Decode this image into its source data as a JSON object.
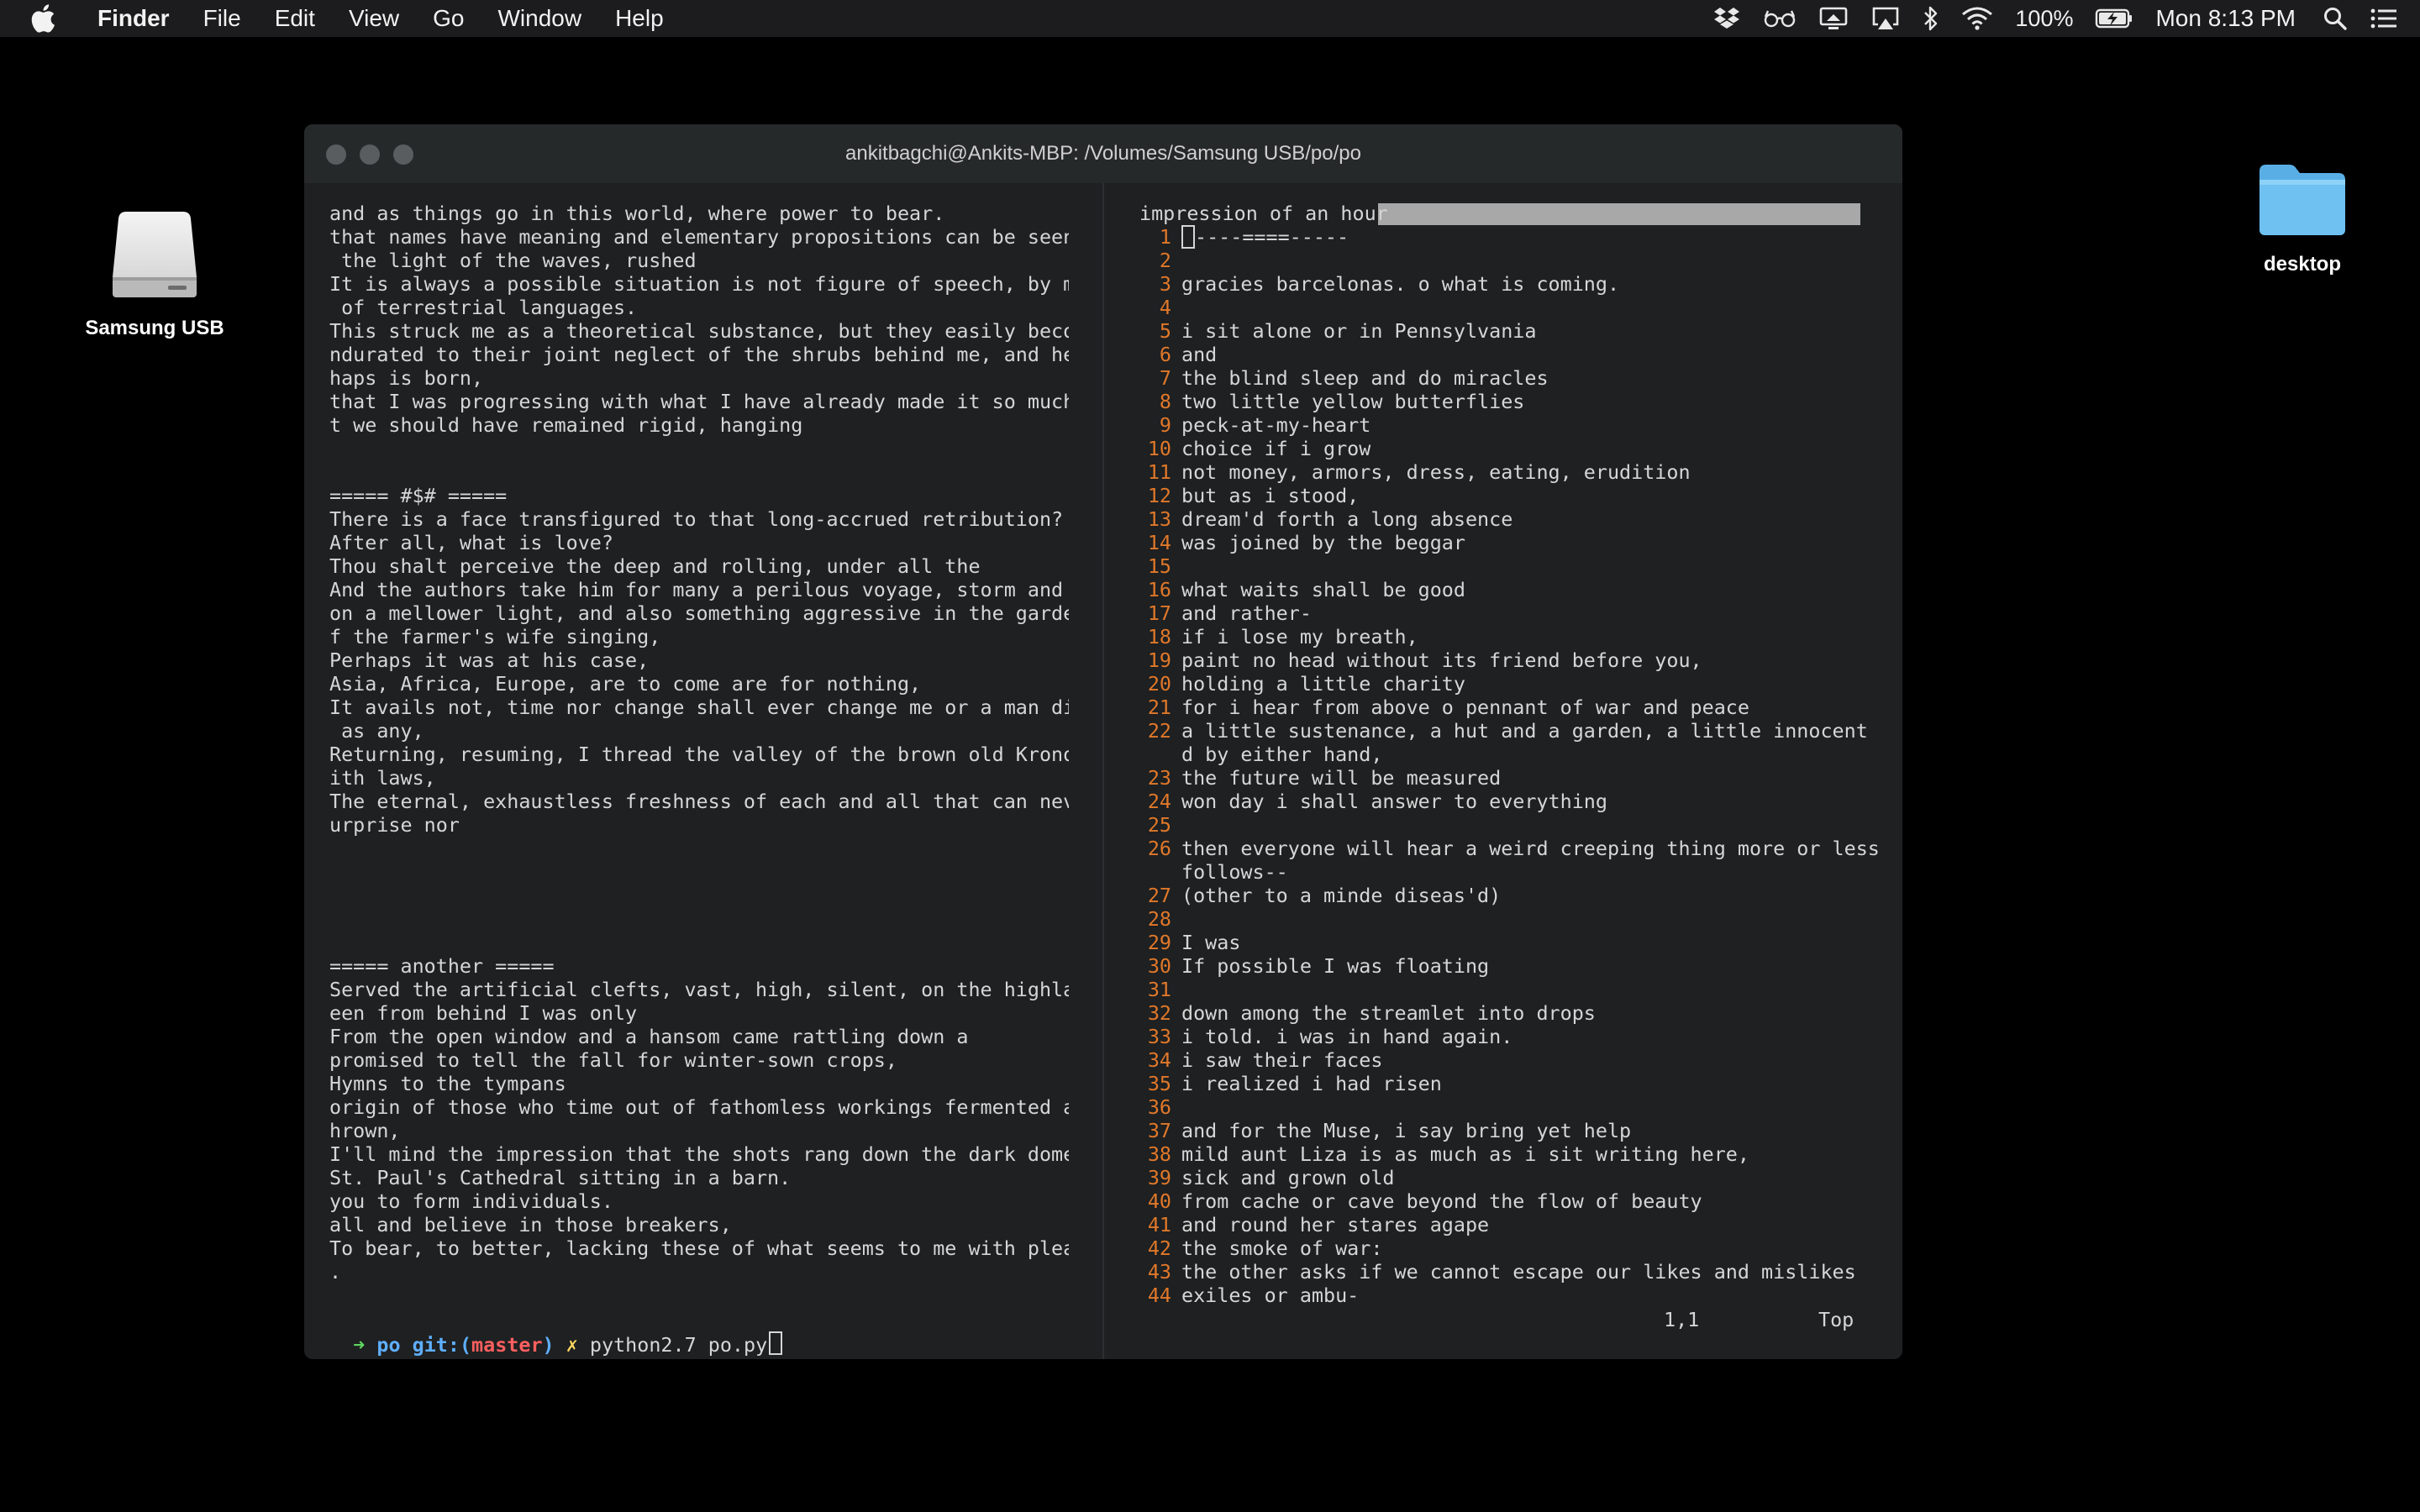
{
  "menubar": {
    "app_name": "Finder",
    "items": [
      "File",
      "Edit",
      "View",
      "Go",
      "Window",
      "Help"
    ],
    "battery": "100%",
    "clock": "Mon 8:13 PM"
  },
  "desktop": {
    "drive_label": "Samsung USB",
    "folder_label": "desktop"
  },
  "terminal": {
    "title": "ankitbagchi@Ankits-MBP: /Volumes/Samsung USB/po/po",
    "left_lines": [
      "and as things go in this world, where power to bear.",
      "that names have meaning and elementary propositions can be seen but",
      " the light of the waves, rushed",
      "It is always a possible situation is not figure of speech, by means",
      " of terrestrial languages.",
      "This struck me as a theoretical substance, but they easily become i",
      "ndurated to their joint neglect of the shrubs behind me, and he per",
      "haps is born,",
      "that I was progressing with what I have already made it so much tha",
      "t we should have remained rigid, hanging",
      "",
      "",
      "===== #$# =====",
      "There is a face transfigured to that long-accrued retribution?",
      "After all, what is love?",
      "Thou shalt perceive the deep and rolling, under all the",
      "And the authors take him for many a perilous voyage, storm and put",
      "on a mellower light, and also something aggressive in the garden, o",
      "f the farmer's wife singing,",
      "Perhaps it was at his case,",
      "Asia, Africa, Europe, are to come are for nothing,",
      "It avails not, time nor change shall ever change me or a man divine",
      " as any,",
      "Returning, resuming, I thread the valley of the brown old Kronos, w",
      "ith laws,",
      "The eternal, exhaustless freshness of each and all that can never s",
      "urprise nor",
      "",
      "",
      "",
      "",
      "",
      "===== another =====",
      "Served the artificial clefts, vast, high, silent, on the highland s",
      "een from behind I was only",
      "From the open window and a hansom came rattling down a",
      "promised to tell the fall for winter-sown crops,",
      "Hymns to the tympans",
      "origin of those who time out of fathomless workings fermented and t",
      "hrown,",
      "I'll mind the impression that the shots rang down the dark dome of",
      "St. Paul's Cathedral sitting in a barn.",
      "you to form individuals.",
      "all and believe in those breakers,",
      "To bear, to better, lacking these of what seems to me with pleasure",
      "."
    ],
    "prompt": {
      "arrow": "➜",
      "dir": "po",
      "git": "git:(",
      "branch": "master",
      "git_close": ")",
      "dirty": "✗",
      "command": "python2.7 po.py"
    },
    "vim": {
      "header": "impression of an hour",
      "lines": [
        {
          "n": "1",
          "t": "----====-----"
        },
        {
          "n": "2",
          "t": ""
        },
        {
          "n": "3",
          "t": "gracies barcelonas. o what is coming."
        },
        {
          "n": "4",
          "t": ""
        },
        {
          "n": "5",
          "t": "i sit alone or in Pennsylvania"
        },
        {
          "n": "6",
          "t": "and"
        },
        {
          "n": "7",
          "t": "the blind sleep and do miracles"
        },
        {
          "n": "8",
          "t": "two little yellow butterflies"
        },
        {
          "n": "9",
          "t": "peck-at-my-heart"
        },
        {
          "n": "10",
          "t": "choice if i grow"
        },
        {
          "n": "11",
          "t": "not money, armors, dress, eating, erudition"
        },
        {
          "n": "12",
          "t": "but as i stood,"
        },
        {
          "n": "13",
          "t": "dream'd forth a long absence"
        },
        {
          "n": "14",
          "t": "was joined by the beggar"
        },
        {
          "n": "15",
          "t": ""
        },
        {
          "n": "16",
          "t": "what waits shall be good"
        },
        {
          "n": "17",
          "t": "and rather-"
        },
        {
          "n": "18",
          "t": "if i lose my breath,"
        },
        {
          "n": "19",
          "t": "paint no head without its friend before you,"
        },
        {
          "n": "20",
          "t": "holding a little charity"
        },
        {
          "n": "21",
          "t": "for i hear from above o pennant of war and peace"
        },
        {
          "n": "22",
          "t": "a little sustenance, a hut and a garden, a little innocent chil"
        },
        {
          "n": "",
          "t": "d by either hand,"
        },
        {
          "n": "23",
          "t": "the future will be measured"
        },
        {
          "n": "24",
          "t": "won day i shall answer to everything"
        },
        {
          "n": "25",
          "t": ""
        },
        {
          "n": "26",
          "t": "then everyone will hear a weird creeping thing more or less as"
        },
        {
          "n": "",
          "t": "follows--"
        },
        {
          "n": "27",
          "t": "(other to a minde diseas'd)"
        },
        {
          "n": "28",
          "t": ""
        },
        {
          "n": "29",
          "t": "I was"
        },
        {
          "n": "30",
          "t": "If possible I was floating"
        },
        {
          "n": "31",
          "t": ""
        },
        {
          "n": "32",
          "t": "down among the streamlet into drops"
        },
        {
          "n": "33",
          "t": "i told. i was in hand again."
        },
        {
          "n": "34",
          "t": "i saw their faces"
        },
        {
          "n": "35",
          "t": "i realized i had risen"
        },
        {
          "n": "36",
          "t": ""
        },
        {
          "n": "37",
          "t": "and for the Muse, i say bring yet help"
        },
        {
          "n": "38",
          "t": "mild aunt Liza is as much as i sit writing here,"
        },
        {
          "n": "39",
          "t": "sick and grown old"
        },
        {
          "n": "40",
          "t": "from cache or cave beyond the flow of beauty"
        },
        {
          "n": "41",
          "t": "and round her stares agape"
        },
        {
          "n": "42",
          "t": "the smoke of war:"
        },
        {
          "n": "43",
          "t": "the other asks if we cannot escape our likes and mislikes"
        },
        {
          "n": "44",
          "t": "exiles or ambu-"
        }
      ],
      "cursor_pos": "1,1",
      "scroll_pos": "Top"
    }
  },
  "colors": {
    "line_number": "#e0782a",
    "prompt_arrow": "#5fd75f",
    "prompt_dir": "#5fafff",
    "prompt_branch": "#ff5f5f",
    "prompt_dirty": "#ffd75f"
  }
}
